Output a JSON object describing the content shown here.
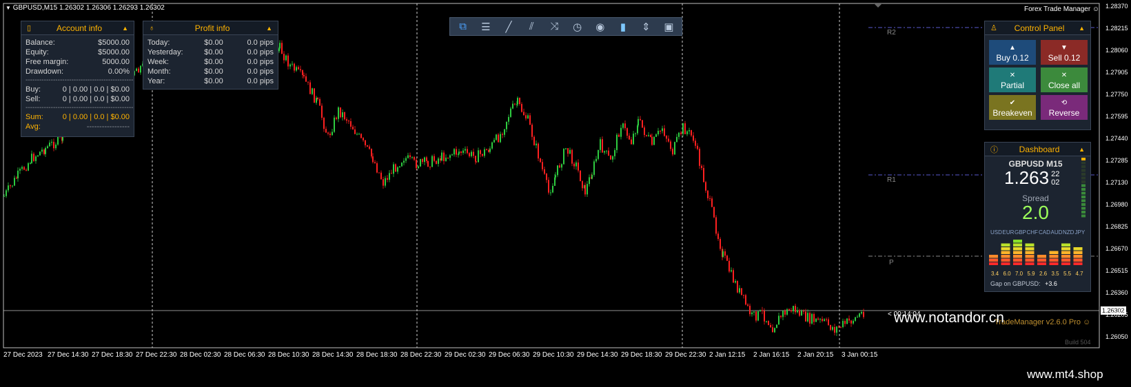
{
  "chart_header": "GBPUSD,M15  1.26302 1.26306 1.26293 1.26302",
  "top_right_label": "Forex Trade Manager ☺",
  "account_info": {
    "title": "Account info",
    "balance_label": "Balance:",
    "balance": "$5000.00",
    "equity_label": "Equity:",
    "equity": "$5000.00",
    "free_margin_label": "Free margin:",
    "free_margin": "5000.00",
    "drawdown_label": "Drawdown:",
    "drawdown": "0.00%",
    "separator": "------------------------------------------------",
    "buy_label": "Buy:",
    "buy": "0 | 0.00 | 0.0 | $0.00",
    "sell_label": "Sell:",
    "sell": "0 | 0.00 | 0.0 | $0.00",
    "sum_label": "Sum:",
    "sum": "0 | 0.00 | 0.0 | $0.00",
    "avg_label": "Avg:",
    "avg": "-----------------"
  },
  "profit_info": {
    "title": "Profit info",
    "rows": [
      {
        "label": "Today:",
        "money": "$0.00",
        "pips": "0.0 pips"
      },
      {
        "label": "Yesterday:",
        "money": "$0.00",
        "pips": "0.0 pips"
      },
      {
        "label": "Week:",
        "money": "$0.00",
        "pips": "0.0 pips"
      },
      {
        "label": "Month:",
        "money": "$0.00",
        "pips": "0.0 pips"
      },
      {
        "label": "Year:",
        "money": "$0.00",
        "pips": "0.0 pips"
      }
    ]
  },
  "toolbar": {
    "icons": [
      "windows-icon",
      "menu-icon",
      "trendline-icon",
      "channel-icon",
      "shuffle-icon",
      "clock-icon",
      "eye-icon",
      "trash-icon",
      "split-icon",
      "camera-icon"
    ]
  },
  "control_panel": {
    "title": "Control Panel",
    "buy": "Buy 0.12",
    "sell": "Sell 0.12",
    "partial": "Partial",
    "close_all": "Close all",
    "breakeven": "Breakeven",
    "reverse": "Reverse"
  },
  "dashboard": {
    "title": "Dashboard",
    "symbol": "GBPUSD M15",
    "price_main": "1.263",
    "price_small_top": "22",
    "price_small_bottom": "02",
    "spread_label": "Spread",
    "spread": "2.0",
    "currencies": [
      "USD",
      "EUR",
      "GBP",
      "CHF",
      "CAD",
      "AUD",
      "NZD",
      "JPY"
    ],
    "strengths": [
      3.4,
      6.0,
      7.0,
      5.9,
      2.6,
      3.5,
      5.5,
      4.7
    ],
    "strength_labels": [
      "3.4",
      "6.0",
      "7.0",
      "5.9",
      "2.6",
      "3.5",
      "5.5",
      "4.7"
    ],
    "gap_label": "Gap on GBPUSD:",
    "gap": "+3.6"
  },
  "pivots": {
    "r2": "R2",
    "r1": "R1",
    "p": "P"
  },
  "price_tags": {
    "current": "1.26302",
    "timer": "< 00:14:04"
  },
  "overlay_text": {
    "version": "TradeManager v2.6.0 Pro ☺",
    "build": "Build 504",
    "watermark_cn": "www.notandor.cn",
    "watermark_shop": "www.mt4.shop"
  },
  "y_axis": [
    "1.28370",
    "1.28215",
    "1.28060",
    "1.27905",
    "1.27750",
    "1.27595",
    "1.27440",
    "1.27285",
    "1.27130",
    "1.26980",
    "1.26825",
    "1.26670",
    "1.26515",
    "1.26360",
    "1.26205",
    "1.26050"
  ],
  "x_axis": [
    "27 Dec 2023",
    "27 Dec 14:30",
    "27 Dec 18:30",
    "27 Dec 22:30",
    "28 Dec 02:30",
    "28 Dec 06:30",
    "28 Dec 10:30",
    "28 Dec 14:30",
    "28 Dec 18:30",
    "28 Dec 22:30",
    "29 Dec 02:30",
    "29 Dec 06:30",
    "29 Dec 10:30",
    "29 Dec 14:30",
    "29 Dec 18:30",
    "29 Dec 22:30",
    "2 Jan 12:15",
    "2 Jan 16:15",
    "2 Jan 20:15",
    "3 Jan 00:15"
  ],
  "colors": {
    "bull": "#2ecc40",
    "bear": "#ff2020",
    "pivot": "#5a5ad0",
    "bg": "#000000"
  }
}
